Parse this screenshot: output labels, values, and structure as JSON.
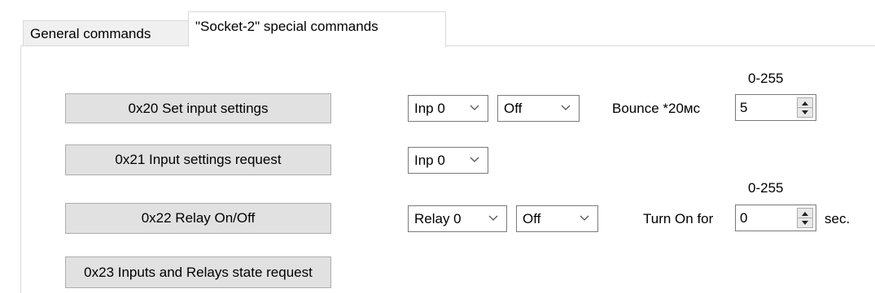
{
  "tabs": [
    {
      "label": "General commands",
      "active": false
    },
    {
      "label": "\"Socket-2\" special commands",
      "active": true
    }
  ],
  "rows": {
    "set_input": {
      "button": "0x20 Set input settings",
      "input_combo": "Inp 0",
      "state_combo": "Off",
      "field_label": "Bounce *20мс",
      "range_label": "0-255",
      "value": "5"
    },
    "input_request": {
      "button": "0x21 Input settings request",
      "input_combo": "Inp 0"
    },
    "relay": {
      "button": "0x22 Relay On/Off",
      "relay_combo": "Relay 0",
      "state_combo": "Off",
      "field_label": "Turn On for",
      "range_label": "0-255",
      "value": "0",
      "unit": "sec."
    },
    "state_request": {
      "button": "0x23 Inputs and Relays state request"
    }
  },
  "colors": {
    "button_bg": "#e1e1e1",
    "button_border": "#adadad",
    "field_border": "#7a7a7a",
    "tab_inactive_bg": "#f0f0f0"
  },
  "icons": {
    "dropdown": "chevron-down-icon",
    "spin_up": "triangle-up-icon",
    "spin_down": "triangle-down-icon"
  }
}
